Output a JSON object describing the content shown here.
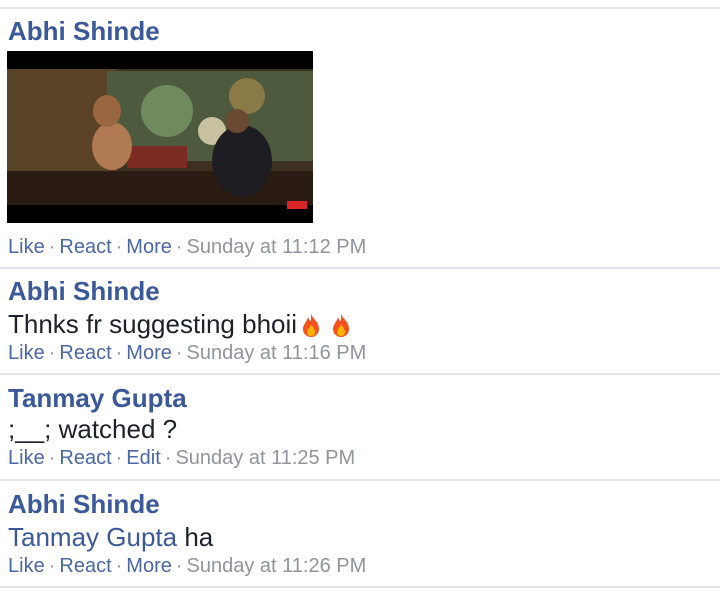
{
  "comments": [
    {
      "author": "Abhi Shinde",
      "media": "video-thumbnail",
      "actions": {
        "like": "Like",
        "react": "React",
        "third": "More",
        "timestamp": "Sunday at 11:12 PM"
      }
    },
    {
      "author": "Abhi Shinde",
      "text": "Thnks fr suggesting bhoii",
      "emoji": [
        "fire-icon",
        "fire-icon"
      ],
      "actions": {
        "like": "Like",
        "react": "React",
        "third": "More",
        "timestamp": "Sunday at 11:16 PM"
      }
    },
    {
      "author": "Tanmay Gupta",
      "text": ";__; watched ?",
      "actions": {
        "like": "Like",
        "react": "React",
        "third": "Edit",
        "timestamp": "Sunday at 11:25 PM"
      }
    },
    {
      "author": "Abhi Shinde",
      "mention": "Tanmay Gupta",
      "text": " ha",
      "actions": {
        "like": "Like",
        "react": "React",
        "third": "More",
        "timestamp": "Sunday at 11:26 PM"
      }
    }
  ],
  "colors": {
    "author": "#3b5998",
    "link": "#4b67a1",
    "meta": "#90949c",
    "text": "#1d2129",
    "divider": "#e3e5e9"
  }
}
